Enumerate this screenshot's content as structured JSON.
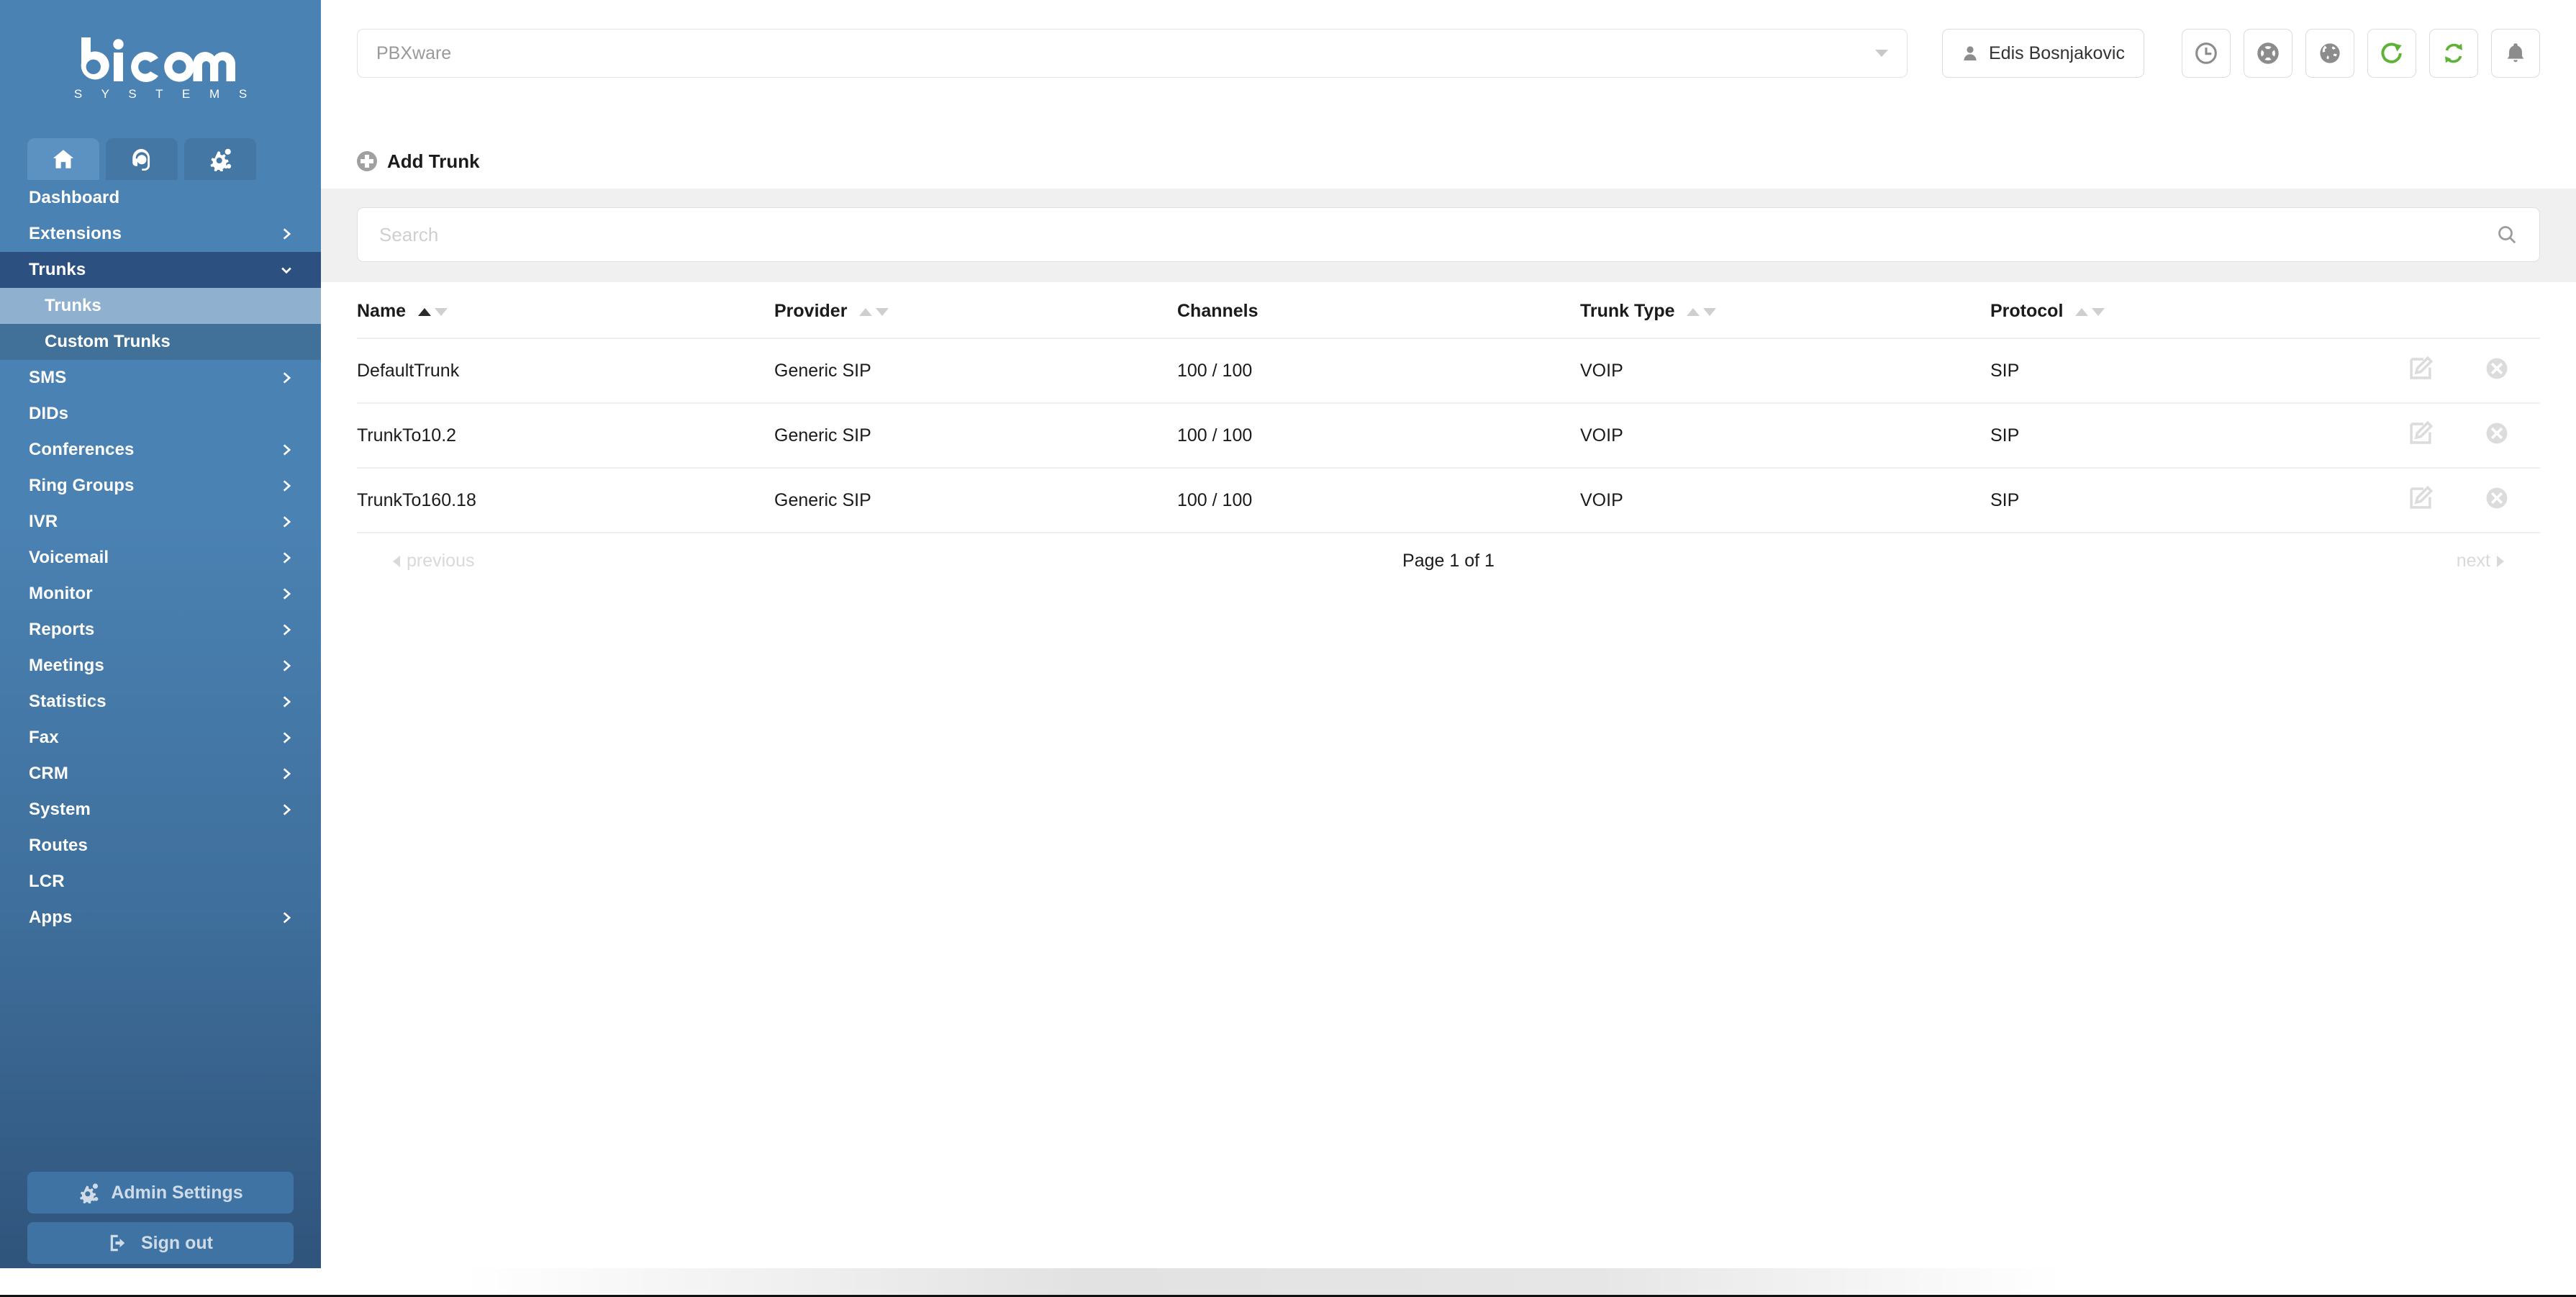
{
  "brand": {
    "name": "bicom",
    "subtitle": "S Y S T E M S"
  },
  "sidebar": {
    "icon_tabs": [
      {
        "name": "home-icon",
        "label": "Home",
        "active": true
      },
      {
        "name": "headset-icon",
        "label": "Support",
        "active": false
      },
      {
        "name": "gears-icon",
        "label": "Settings",
        "active": false
      }
    ],
    "items": [
      {
        "label": "Dashboard",
        "chevron": "none",
        "state": "normal"
      },
      {
        "label": "Extensions",
        "chevron": "right",
        "state": "normal"
      },
      {
        "label": "Trunks",
        "chevron": "down",
        "state": "open"
      },
      {
        "label": "Trunks",
        "chevron": "none",
        "state": "sub-active"
      },
      {
        "label": "Custom Trunks",
        "chevron": "none",
        "state": "sub"
      },
      {
        "label": "SMS",
        "chevron": "right",
        "state": "normal"
      },
      {
        "label": "DIDs",
        "chevron": "none",
        "state": "normal"
      },
      {
        "label": "Conferences",
        "chevron": "right",
        "state": "normal"
      },
      {
        "label": "Ring Groups",
        "chevron": "right",
        "state": "normal"
      },
      {
        "label": "IVR",
        "chevron": "right",
        "state": "normal"
      },
      {
        "label": "Voicemail",
        "chevron": "right",
        "state": "normal"
      },
      {
        "label": "Monitor",
        "chevron": "right",
        "state": "normal"
      },
      {
        "label": "Reports",
        "chevron": "right",
        "state": "normal"
      },
      {
        "label": "Meetings",
        "chevron": "right",
        "state": "normal"
      },
      {
        "label": "Statistics",
        "chevron": "right",
        "state": "normal"
      },
      {
        "label": "Fax",
        "chevron": "right",
        "state": "normal"
      },
      {
        "label": "CRM",
        "chevron": "right",
        "state": "normal"
      },
      {
        "label": "System",
        "chevron": "right",
        "state": "normal"
      },
      {
        "label": "Routes",
        "chevron": "none",
        "state": "normal"
      },
      {
        "label": "LCR",
        "chevron": "none",
        "state": "normal"
      },
      {
        "label": "Apps",
        "chevron": "right",
        "state": "normal"
      }
    ],
    "admin_settings_label": "Admin Settings",
    "sign_out_label": "Sign out"
  },
  "topbar": {
    "server_select_value": "PBXware",
    "user_name": "Edis Bosnjakovic",
    "icon_buttons": [
      {
        "name": "clock-icon",
        "color": "#8c8c8c"
      },
      {
        "name": "life-ring-icon",
        "color": "#8c8c8c"
      },
      {
        "name": "globe-icon",
        "color": "#8c8c8c"
      },
      {
        "name": "reload-icon",
        "color": "#5cb335"
      },
      {
        "name": "sync-icon",
        "color": "#5cb335"
      },
      {
        "name": "bell-icon",
        "color": "#8c8c8c"
      }
    ]
  },
  "actions": {
    "add_trunk_label": "Add Trunk"
  },
  "search": {
    "placeholder": "Search"
  },
  "table": {
    "columns": [
      {
        "label": "Name",
        "sort_asc_active": true,
        "sort_desc_active": false,
        "sortable": true
      },
      {
        "label": "Provider",
        "sort_asc_active": false,
        "sort_desc_active": false,
        "sortable": true
      },
      {
        "label": "Channels",
        "sortable": false
      },
      {
        "label": "Trunk Type",
        "sort_asc_active": false,
        "sort_desc_active": false,
        "sortable": true
      },
      {
        "label": "Protocol",
        "sort_asc_active": false,
        "sort_desc_active": false,
        "sortable": true
      }
    ],
    "rows": [
      {
        "name": "DefaultTrunk",
        "provider": "Generic SIP",
        "channels": "100 / 100",
        "trunk_type": "VOIP",
        "protocol": "SIP"
      },
      {
        "name": "TrunkTo10.2",
        "provider": "Generic SIP",
        "channels": "100 / 100",
        "trunk_type": "VOIP",
        "protocol": "SIP"
      },
      {
        "name": "TrunkTo160.18",
        "provider": "Generic SIP",
        "channels": "100 / 100",
        "trunk_type": "VOIP",
        "protocol": "SIP"
      }
    ],
    "row_actions": [
      {
        "name": "edit-icon"
      },
      {
        "name": "delete-icon"
      }
    ]
  },
  "pagination": {
    "previous_label": "previous",
    "page_label": "Page 1 of 1",
    "next_label": "next"
  },
  "colors": {
    "sidebar_top": "#4a82b3",
    "sidebar_bottom": "#2e5279",
    "sidebar_active_sub": "#8fb0ce",
    "sidebar_open": "#2c5180",
    "accent_green": "#5cb335",
    "band_grey": "#f0f0f0"
  }
}
